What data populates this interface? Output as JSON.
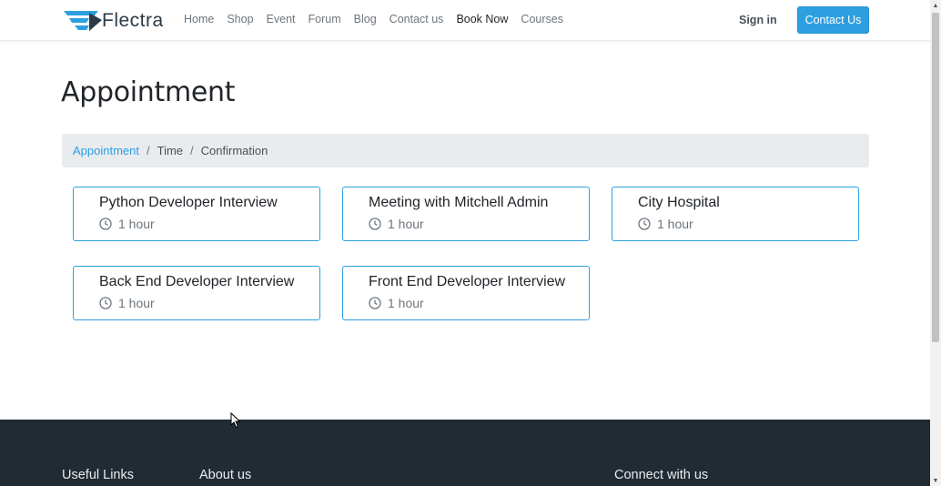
{
  "brand": {
    "name": "Flectra"
  },
  "nav": {
    "items": [
      {
        "label": "Home"
      },
      {
        "label": "Shop"
      },
      {
        "label": "Event"
      },
      {
        "label": "Forum"
      },
      {
        "label": "Blog"
      },
      {
        "label": "Contact us"
      },
      {
        "label": "Book Now",
        "active": true
      },
      {
        "label": "Courses"
      }
    ],
    "sign_in": "Sign in",
    "contact_button": "Contact Us"
  },
  "page": {
    "title": "Appointment"
  },
  "breadcrumb": {
    "items": [
      "Appointment",
      "Time",
      "Confirmation"
    ],
    "separator": "/"
  },
  "appointments": [
    {
      "name": "Python Developer Interview",
      "duration": "1 hour"
    },
    {
      "name": "Meeting with Mitchell Admin",
      "duration": "1 hour"
    },
    {
      "name": "City Hospital",
      "duration": "1 hour"
    },
    {
      "name": "Back End Developer Interview",
      "duration": "1 hour"
    },
    {
      "name": "Front End Developer Interview",
      "duration": "1 hour"
    }
  ],
  "footer": {
    "headings": [
      "Useful Links",
      "About us",
      "Connect with us"
    ]
  },
  "colors": {
    "accent": "#2d9fe0",
    "footer_bg": "#212b33",
    "breadcrumb_bg": "#e9ecef"
  },
  "icons": [
    "clock-icon",
    "flectra-logo-icon"
  ]
}
